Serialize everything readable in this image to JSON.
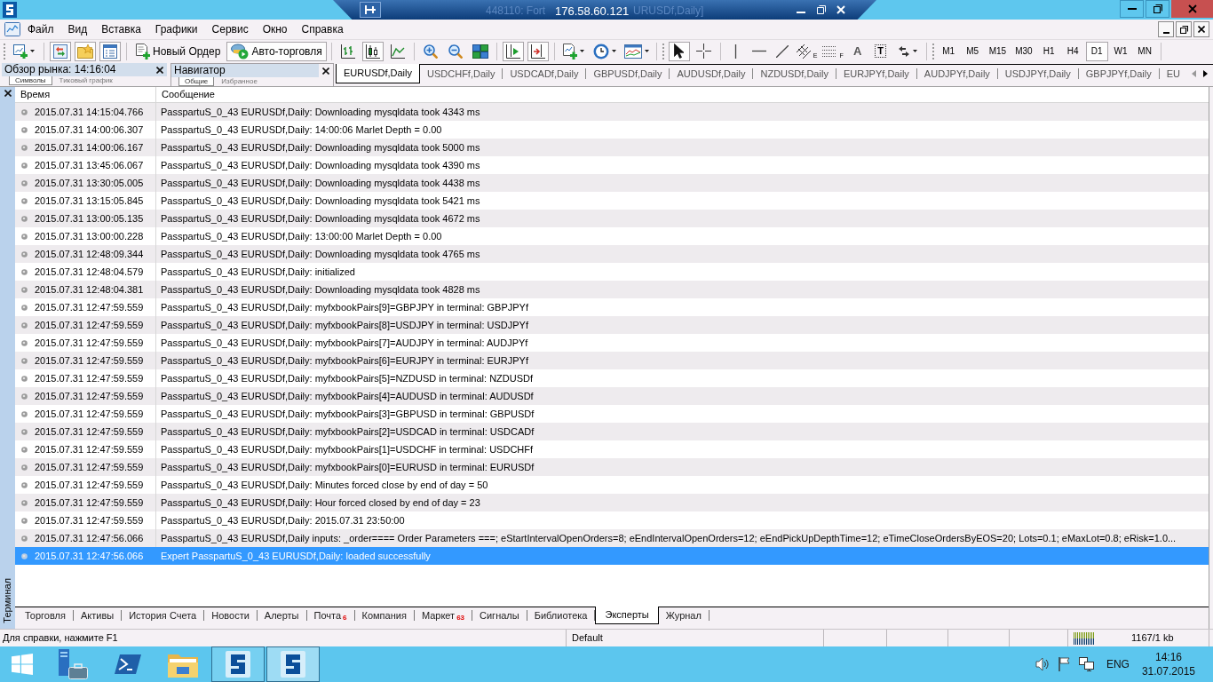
{
  "window": {
    "title_start": "448110: Fort",
    "title_end": "URUSDf,Daily]"
  },
  "remote_bar": {
    "address": "176.58.60.121"
  },
  "menu": [
    "Файл",
    "Вид",
    "Вставка",
    "Графики",
    "Сервис",
    "Окно",
    "Справка"
  ],
  "toolbar": {
    "panel_toggles": [
      {
        "kind": "market",
        "on": true
      },
      {
        "kind": "folder",
        "on": true
      },
      {
        "kind": "list",
        "on": true
      }
    ],
    "order_buttons": [
      {
        "kind": "order",
        "label": "Новый Ордер",
        "on": false
      },
      {
        "kind": "auto",
        "label": "Авто-торговля",
        "on": true
      }
    ],
    "chart_types": [
      {
        "kind": "bars",
        "selected": false
      },
      {
        "kind": "candles",
        "selected": true
      },
      {
        "kind": "line",
        "selected": false
      }
    ],
    "chart_shift": {
      "on": true
    },
    "auto_scroll": {
      "on": true
    },
    "pointer_tools": [
      {
        "kind": "cursor",
        "selected": true
      },
      {
        "kind": "crosshair",
        "selected": false
      }
    ],
    "drawing_tools": [
      {
        "kind": "vline"
      },
      {
        "kind": "hline"
      },
      {
        "kind": "trend"
      },
      {
        "kind": "channel",
        "glyph": "E"
      },
      {
        "kind": "fibo",
        "glyph": "F"
      },
      {
        "kind": "text",
        "glyph": "A"
      },
      {
        "kind": "label",
        "glyph": "T"
      },
      {
        "kind": "arrows"
      }
    ],
    "timeframes": [
      {
        "label": "M1",
        "selected": false
      },
      {
        "label": "M5",
        "selected": false
      },
      {
        "label": "M15",
        "selected": false
      },
      {
        "label": "M30",
        "selected": false
      },
      {
        "label": "H1",
        "selected": false
      },
      {
        "label": "H4",
        "selected": false
      },
      {
        "label": "D1",
        "selected": true
      },
      {
        "label": "W1",
        "selected": false
      },
      {
        "label": "MN",
        "selected": false
      }
    ]
  },
  "panels": [
    {
      "title": "Обзор рынка: 14:16:04",
      "tabs": [
        {
          "label": "Символы",
          "selected": true
        },
        {
          "label": "Тиковый график",
          "selected": false
        }
      ]
    },
    {
      "title": "Навигатор",
      "tabs": [
        {
          "label": "Общие",
          "selected": true
        },
        {
          "label": "Избранное",
          "selected": false
        }
      ]
    }
  ],
  "chart_tabs": [
    {
      "label": "EURUSDf,Daily",
      "selected": true
    },
    {
      "label": "USDCHFf,Daily",
      "selected": false
    },
    {
      "label": "USDCADf,Daily",
      "selected": false
    },
    {
      "label": "GBPUSDf,Daily",
      "selected": false
    },
    {
      "label": "AUDUSDf,Daily",
      "selected": false
    },
    {
      "label": "NZDUSDf,Daily",
      "selected": false
    },
    {
      "label": "EURJPYf,Daily",
      "selected": false
    },
    {
      "label": "AUDJPYf,Daily",
      "selected": false
    },
    {
      "label": "USDJPYf,Daily",
      "selected": false
    },
    {
      "label": "GBPJPYf,Daily",
      "selected": false
    },
    {
      "label": "EU",
      "selected": false
    }
  ],
  "terminal": {
    "title": "Терминал",
    "columns": [
      "Время",
      "Сообщение"
    ],
    "rows": [
      {
        "time": "2015.07.31 14:15:04.766",
        "message": "PasspartuS_0_43 EURUSDf,Daily: Downloading mysqldata took 4343 ms",
        "selected": false
      },
      {
        "time": "2015.07.31 14:00:06.307",
        "message": "PasspartuS_0_43 EURUSDf,Daily: 14:00:06 Marlet Depth = 0.00",
        "selected": false
      },
      {
        "time": "2015.07.31 14:00:06.167",
        "message": "PasspartuS_0_43 EURUSDf,Daily: Downloading mysqldata took 5000 ms",
        "selected": false
      },
      {
        "time": "2015.07.31 13:45:06.067",
        "message": "PasspartuS_0_43 EURUSDf,Daily: Downloading mysqldata took 4390 ms",
        "selected": false
      },
      {
        "time": "2015.07.31 13:30:05.005",
        "message": "PasspartuS_0_43 EURUSDf,Daily: Downloading mysqldata took 4438 ms",
        "selected": false
      },
      {
        "time": "2015.07.31 13:15:05.845",
        "message": "PasspartuS_0_43 EURUSDf,Daily: Downloading mysqldata took 5421 ms",
        "selected": false
      },
      {
        "time": "2015.07.31 13:00:05.135",
        "message": "PasspartuS_0_43 EURUSDf,Daily: Downloading mysqldata took 4672 ms",
        "selected": false
      },
      {
        "time": "2015.07.31 13:00:00.228",
        "message": "PasspartuS_0_43 EURUSDf,Daily: 13:00:00 Marlet Depth = 0.00",
        "selected": false
      },
      {
        "time": "2015.07.31 12:48:09.344",
        "message": "PasspartuS_0_43 EURUSDf,Daily: Downloading mysqldata took 4765 ms",
        "selected": false
      },
      {
        "time": "2015.07.31 12:48:04.579",
        "message": "PasspartuS_0_43 EURUSDf,Daily: initialized",
        "selected": false
      },
      {
        "time": "2015.07.31 12:48:04.381",
        "message": "PasspartuS_0_43 EURUSDf,Daily: Downloading mysqldata took 4828 ms",
        "selected": false
      },
      {
        "time": "2015.07.31 12:47:59.559",
        "message": "PasspartuS_0_43 EURUSDf,Daily: myfxbookPairs[9]=GBPJPY in terminal: GBPJPYf",
        "selected": false
      },
      {
        "time": "2015.07.31 12:47:59.559",
        "message": "PasspartuS_0_43 EURUSDf,Daily: myfxbookPairs[8]=USDJPY in terminal: USDJPYf",
        "selected": false
      },
      {
        "time": "2015.07.31 12:47:59.559",
        "message": "PasspartuS_0_43 EURUSDf,Daily: myfxbookPairs[7]=AUDJPY in terminal: AUDJPYf",
        "selected": false
      },
      {
        "time": "2015.07.31 12:47:59.559",
        "message": "PasspartuS_0_43 EURUSDf,Daily: myfxbookPairs[6]=EURJPY in terminal: EURJPYf",
        "selected": false
      },
      {
        "time": "2015.07.31 12:47:59.559",
        "message": "PasspartuS_0_43 EURUSDf,Daily: myfxbookPairs[5]=NZDUSD in terminal: NZDUSDf",
        "selected": false
      },
      {
        "time": "2015.07.31 12:47:59.559",
        "message": "PasspartuS_0_43 EURUSDf,Daily: myfxbookPairs[4]=AUDUSD in terminal: AUDUSDf",
        "selected": false
      },
      {
        "time": "2015.07.31 12:47:59.559",
        "message": "PasspartuS_0_43 EURUSDf,Daily: myfxbookPairs[3]=GBPUSD in terminal: GBPUSDf",
        "selected": false
      },
      {
        "time": "2015.07.31 12:47:59.559",
        "message": "PasspartuS_0_43 EURUSDf,Daily: myfxbookPairs[2]=USDCAD in terminal: USDCADf",
        "selected": false
      },
      {
        "time": "2015.07.31 12:47:59.559",
        "message": "PasspartuS_0_43 EURUSDf,Daily: myfxbookPairs[1]=USDCHF in terminal: USDCHFf",
        "selected": false
      },
      {
        "time": "2015.07.31 12:47:59.559",
        "message": "PasspartuS_0_43 EURUSDf,Daily: myfxbookPairs[0]=EURUSD in terminal: EURUSDf",
        "selected": false
      },
      {
        "time": "2015.07.31 12:47:59.559",
        "message": "PasspartuS_0_43 EURUSDf,Daily: Minutes forced close by end of day = 50",
        "selected": false
      },
      {
        "time": "2015.07.31 12:47:59.559",
        "message": "PasspartuS_0_43 EURUSDf,Daily: Hour forced closed by end of day = 23",
        "selected": false
      },
      {
        "time": "2015.07.31 12:47:59.559",
        "message": "PasspartuS_0_43 EURUSDf,Daily: 2015.07.31 23:50:00",
        "selected": false
      },
      {
        "time": "2015.07.31 12:47:56.066",
        "message": "PasspartuS_0_43 EURUSDf,Daily inputs: _order==== Order Parameters ===; eStartIntervalOpenOrders=8; eEndIntervalOpenOrders=12; eEndPickUpDepthTime=12; eTimeCloseOrdersByEOS=20; Lots=0.1; eMaxLot=0.8; eRisk=1.0...",
        "selected": false
      },
      {
        "time": "2015.07.31 12:47:56.066",
        "message": "Expert PasspartuS_0_43 EURUSDf,Daily: loaded successfully",
        "selected": true
      }
    ],
    "tabs": [
      {
        "label": "Торговля",
        "selected": false
      },
      {
        "label": "Активы",
        "selected": false
      },
      {
        "label": "История Счета",
        "selected": false
      },
      {
        "label": "Новости",
        "selected": false
      },
      {
        "label": "Алерты",
        "selected": false
      },
      {
        "label": "Почта",
        "badge": "6",
        "selected": false
      },
      {
        "label": "Компания",
        "selected": false
      },
      {
        "label": "Маркет",
        "badge": "63",
        "selected": false
      },
      {
        "label": "Сигналы",
        "selected": false
      },
      {
        "label": "Библиотека",
        "selected": false
      },
      {
        "label": "Эксперты",
        "selected": true
      },
      {
        "label": "Журнал",
        "selected": false
      }
    ]
  },
  "status_bar": {
    "help": "Для справки, нажмите F1",
    "profile": "Default",
    "traffic": "1167/1 kb"
  },
  "taskbar": {
    "apps": [
      {
        "kind": "server",
        "running": false,
        "active": false
      },
      {
        "kind": "powershell",
        "running": false,
        "active": false
      },
      {
        "kind": "explorer",
        "running": false,
        "active": false
      },
      {
        "kind": "terminal",
        "running": true,
        "active": false
      },
      {
        "kind": "terminal",
        "running": true,
        "active": true
      }
    ],
    "language": "ENG",
    "time": "14:16",
    "date": "31.07.2015"
  }
}
